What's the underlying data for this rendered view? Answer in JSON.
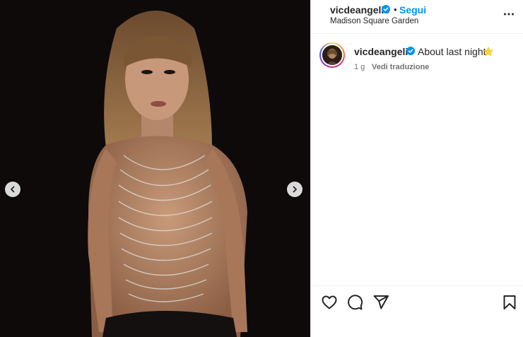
{
  "post": {
    "username": "vicdeangelis",
    "separator": "•",
    "follow_label": "Segui",
    "location": "Madison Square Garden"
  },
  "caption": {
    "username": "vicdeangelis",
    "text": "About last night",
    "emoji_icon": "star-icon",
    "time": "1 g",
    "translate_label": "Vedi traduzione"
  },
  "icons": {
    "verified": "verified-badge-icon",
    "more": "more-options-icon",
    "prev": "chevron-left-icon",
    "next": "chevron-right-icon",
    "like": "heart-icon",
    "comment": "comment-icon",
    "share": "share-icon",
    "save": "bookmark-icon"
  },
  "colors": {
    "accent": "#0095f6",
    "text": "#262626",
    "secondary": "#737373"
  }
}
